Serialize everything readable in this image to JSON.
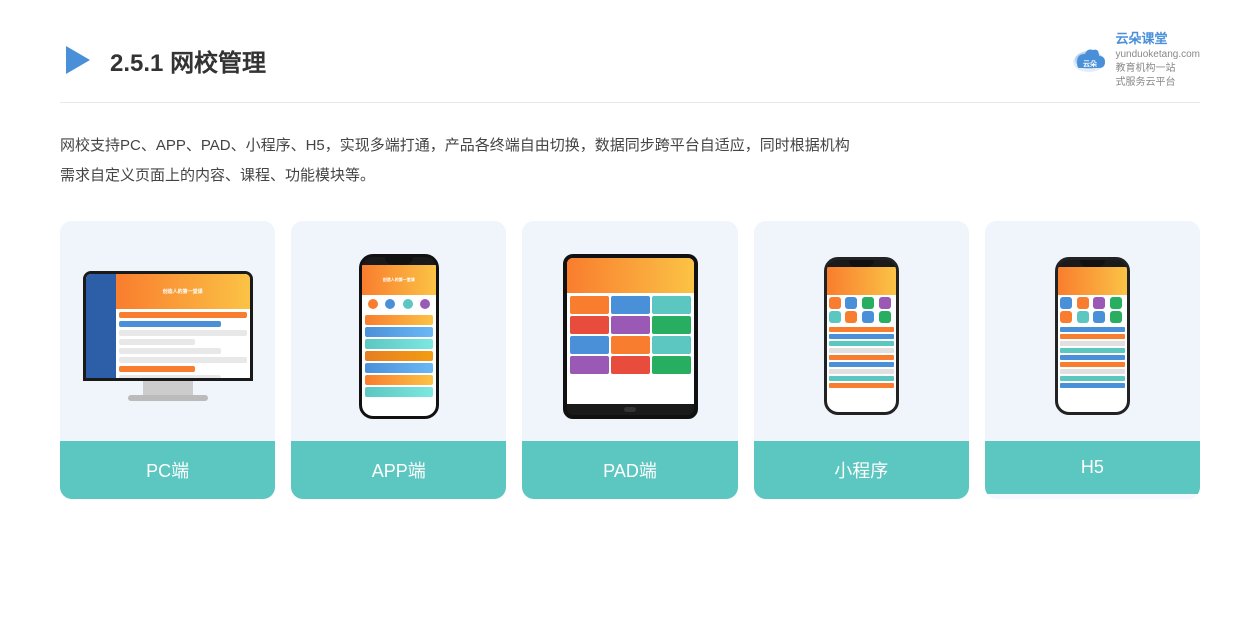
{
  "header": {
    "section_number": "2.5.1",
    "title_bold": "网校管理",
    "brand_name": "云朵课堂",
    "brand_site": "yunduoketang.com",
    "brand_tagline_1": "教育机构一站",
    "brand_tagline_2": "式服务云平台"
  },
  "description": {
    "text_line1": "网校支持PC、APP、PAD、小程序、H5，实现多端打通，产品各终端自由切换，数据同步跨平台自适应，同时根据机构",
    "text_line2": "需求自定义页面上的内容、课程、功能模块等。"
  },
  "cards": [
    {
      "id": "pc",
      "label": "PC端",
      "type": "pc"
    },
    {
      "id": "app",
      "label": "APP端",
      "type": "phone"
    },
    {
      "id": "pad",
      "label": "PAD端",
      "type": "pad"
    },
    {
      "id": "miniprogram",
      "label": "小程序",
      "type": "mini-phone"
    },
    {
      "id": "h5",
      "label": "H5",
      "type": "mini-phone"
    }
  ],
  "colors": {
    "card_bg": "#f0f4fb",
    "card_label_bg": "#5cc6c0",
    "card_label_text": "#ffffff",
    "title_color": "#333333",
    "description_color": "#444444",
    "brand_color": "#4a90d9"
  }
}
